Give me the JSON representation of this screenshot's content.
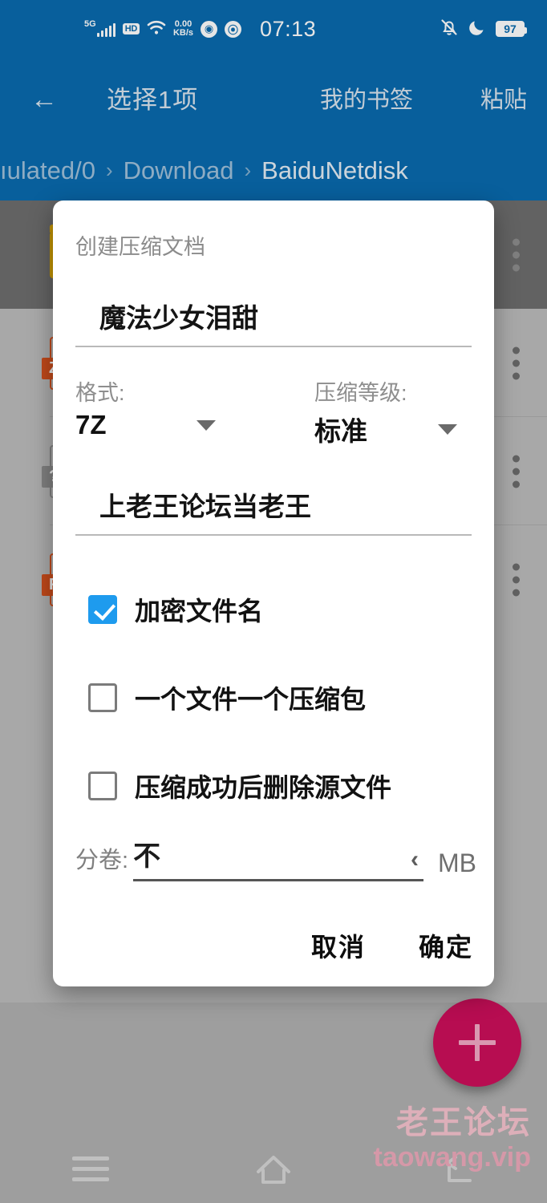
{
  "statusbar": {
    "network_type": "5G",
    "hd_badge": "HD",
    "net_speed_value": "0.00",
    "net_speed_unit": "KB/s",
    "clock": "07:13",
    "battery": "97",
    "icons": [
      "signal-bars-icon",
      "hd-icon",
      "wifi-icon",
      "network-speed-icon",
      "chrome-icon",
      "app-icon",
      "notifications-muted-icon",
      "do-not-disturb-icon",
      "battery-icon"
    ]
  },
  "toolbar": {
    "back_icon": "←",
    "title": "选择1项",
    "bookmark_label": "我的书签",
    "paste_label": "粘贴"
  },
  "breadcrumb": {
    "separator": "›",
    "items": [
      {
        "label": "ıulated/0",
        "current": false
      },
      {
        "label": "Download",
        "current": false
      },
      {
        "label": "BaiduNetdisk",
        "current": true
      }
    ]
  },
  "file_list": {
    "rows": [
      {
        "icon": "folder-icon",
        "tag": "",
        "selected": true
      },
      {
        "icon": "archive-7z-icon",
        "tag": "Z",
        "selected": false
      },
      {
        "icon": "unknown-file-icon",
        "tag": "?",
        "selected": false
      },
      {
        "icon": "archive-rar-icon",
        "tag": "R",
        "selected": false
      }
    ],
    "overflow_icon": "more-vertical-icon"
  },
  "fab": {
    "icon": "plus-icon",
    "color": "#cc0f5b"
  },
  "watermark": {
    "line1": "老王论坛",
    "line2": "taowang.vip"
  },
  "navbar": {
    "recents_icon": "recents-icon",
    "home_icon": "home-icon",
    "back_icon": "back-icon"
  },
  "dialog": {
    "title": "创建压缩文档",
    "filename": {
      "value": "魔法少女泪甜",
      "placeholder": ""
    },
    "password": {
      "value": "上老王论坛当老王",
      "placeholder": ""
    },
    "format": {
      "label": "格式:",
      "value": "7Z",
      "caret_icon": "chevron-down-icon"
    },
    "level": {
      "label": "压缩等级:",
      "value": "标准",
      "caret_icon": "chevron-down-icon"
    },
    "checkboxes": [
      {
        "label": "加密文件名",
        "checked": true
      },
      {
        "label": "一个文件一个压缩包",
        "checked": false
      },
      {
        "label": "压缩成功后删除源文件",
        "checked": false
      }
    ],
    "split": {
      "label": "分卷:",
      "value": "不",
      "chevron_icon": "chevron-left-icon",
      "chevron": "‹",
      "unit": "MB"
    },
    "cancel_label": "取消",
    "confirm_label": "确定"
  },
  "colors": {
    "appbar_blue": "#0A6AAE",
    "checkbox_accent": "#1E9BEE",
    "fab_pink": "#cc0f5b",
    "folder_yellow": "#d9a400",
    "archive_orange": "#d4511e"
  }
}
